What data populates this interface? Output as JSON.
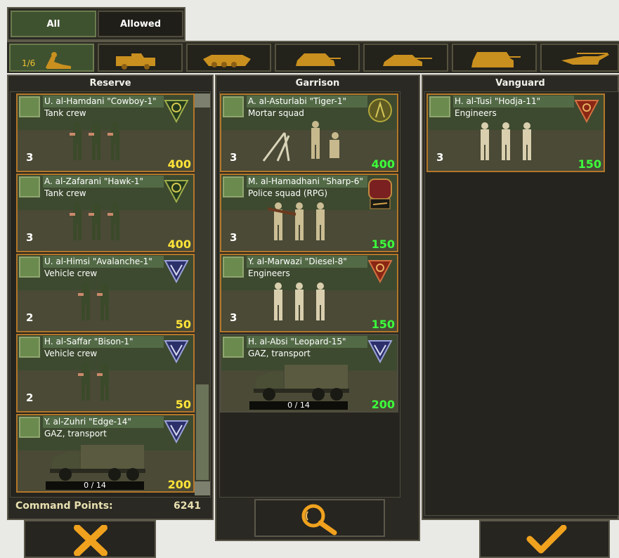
{
  "filters": {
    "all_label": "All",
    "allowed_label": "Allowed"
  },
  "type_bar": {
    "count": "1/6",
    "types": [
      "infantry-icon",
      "truck-icon",
      "apc-icon",
      "tank-icon",
      "tank-icon",
      "heavy-tank-icon",
      "helicopter-icon"
    ]
  },
  "reserve": {
    "title": "Reserve",
    "command_points_label": "Command Points:",
    "command_points_value": "6241",
    "units": [
      {
        "name": "U. al-Hamdani \"Cowboy-1\"",
        "type": "Tank crew",
        "count": "3",
        "points": "400",
        "points_color": "#ffe338",
        "emblem": "green"
      },
      {
        "name": "A. al-Zafarani \"Hawk-1\"",
        "type": "Tank crew",
        "count": "3",
        "points": "400",
        "points_color": "#ffe338",
        "emblem": "green"
      },
      {
        "name": "U. al-Himsi \"Avalanche-1\"",
        "type": "Vehicle crew",
        "count": "2",
        "points": "50",
        "points_color": "#ffe338",
        "emblem": "blue"
      },
      {
        "name": "H. al-Saffar \"Bison-1\"",
        "type": "Vehicle crew",
        "count": "2",
        "points": "50",
        "points_color": "#ffe338",
        "emblem": "blue"
      },
      {
        "name": "Y. al-Zuhri \"Edge-14\"",
        "type": "GAZ, transport",
        "capacity": "0 / 14",
        "points": "200",
        "points_color": "#ffe338",
        "emblem": "blue"
      }
    ]
  },
  "garrison": {
    "title": "Garrison",
    "units": [
      {
        "name": "A. al-Asturlabi \"Tiger-1\"",
        "type": "Mortar squad",
        "count": "3",
        "points": "400",
        "points_color": "#3cff3c",
        "emblem": "olive"
      },
      {
        "name": "M. al-Hamadhani \"Sharp-6\"",
        "type": "Police squad (RPG)",
        "count": "3",
        "points": "150",
        "points_color": "#3cff3c",
        "emblem": "police"
      },
      {
        "name": "Y. al-Marwazi \"Diesel-8\"",
        "type": "Engineers",
        "count": "3",
        "points": "150",
        "points_color": "#3cff3c",
        "emblem": "red"
      },
      {
        "name": "H. al-Absi \"Leopard-15\"",
        "type": "GAZ, transport",
        "capacity": "0 / 14",
        "points": "200",
        "points_color": "#3cff3c",
        "emblem": "blue"
      }
    ]
  },
  "vanguard": {
    "title": "Vanguard",
    "units": [
      {
        "name": "H. al-Tusi \"Hodja-11\"",
        "type": "Engineers",
        "count": "3",
        "points": "150",
        "points_color": "#3cff3c",
        "emblem": "red"
      }
    ]
  },
  "colors": {
    "accent_orange": "#f0a21e",
    "gold": "#c9901f",
    "highlight_green": "#3cff3c",
    "highlight_yellow": "#ffe338"
  },
  "buttons": {
    "cancel_icon": "x-icon",
    "search_icon": "magnifier-icon",
    "confirm_icon": "checkmark-icon"
  }
}
